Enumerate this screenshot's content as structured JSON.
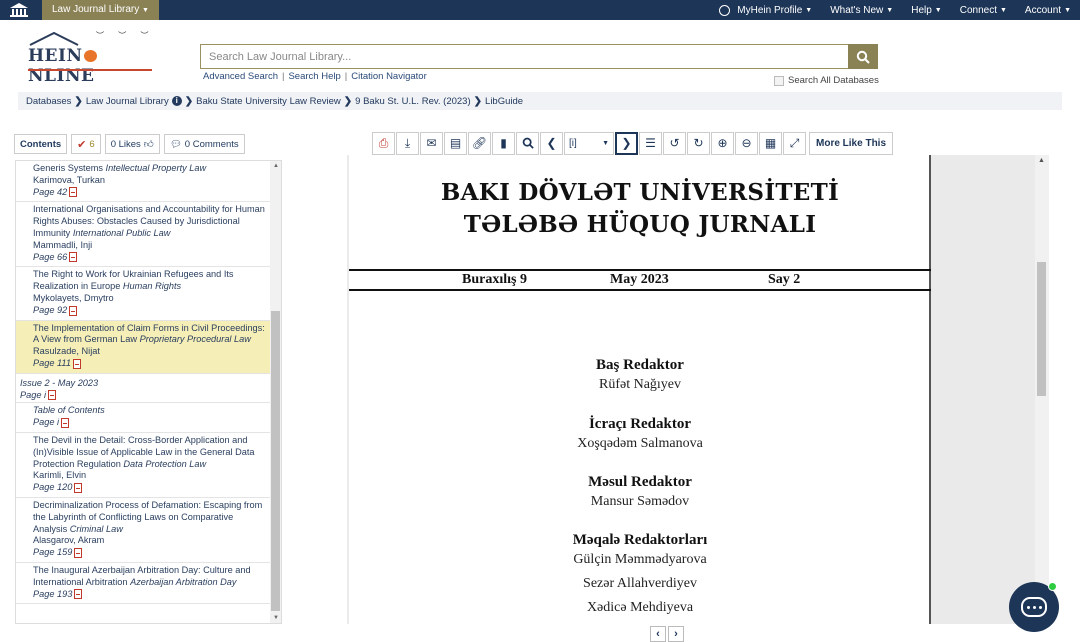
{
  "topnav": {
    "library_tab": "Law Journal Library",
    "items": [
      "MyHein Profile",
      "What's New",
      "Help",
      "Connect",
      "Account"
    ]
  },
  "logo": {
    "text_left": "HEIN",
    "text_right": "NLINE"
  },
  "search": {
    "placeholder": "Search Law Journal Library...",
    "links": [
      "Advanced Search",
      "Search Help",
      "Citation Navigator"
    ],
    "search_all_label": "Search All Databases"
  },
  "breadcrumb": [
    "Databases",
    "Law Journal Library",
    "Baku State University Law Review",
    "9 Baku St. U.L. Rev. (2023)",
    "LibGuide"
  ],
  "left_buttons": {
    "contents": "Contents",
    "count": "6",
    "likes": "0 Likes",
    "comments": "0 Comments"
  },
  "toc": [
    {
      "title": "Generis Systems",
      "category": "Intellectual Property Law",
      "author": "Karimova, Turkan",
      "page": "Page 42"
    },
    {
      "title": "International Organisations and Accountability for Human Rights Abuses: Obstacles Caused by Jurisdictional Immunity",
      "category": "International Public Law",
      "author": "Mammadli, Inji",
      "page": "Page 66"
    },
    {
      "title": "The Right to Work for Ukrainian Refugees and Its Realization in Europe",
      "category": "Human Rights",
      "author": "Mykolayets, Dmytro",
      "page": "Page 92"
    },
    {
      "title": "The Implementation of Claim Forms in Civil Proceedings: A View from German Law",
      "category": "Proprietary Procedural Law",
      "author": "Rasulzade, Nijat",
      "page": "Page 111",
      "highlight": true
    }
  ],
  "issue": {
    "label": "Issue 2 - May 2023",
    "page": "Page i"
  },
  "toc2": [
    {
      "title": "Table of Contents",
      "category": "",
      "author": "",
      "page": "Page i",
      "italic_title": true
    },
    {
      "title": "The Devil in the Detail: Cross-Border Application and (In)Visible Issue of Applicable Law in the General Data Protection Regulation",
      "category": "Data Protection Law",
      "author": "Karimli, Elvin",
      "page": "Page 120"
    },
    {
      "title": "Decriminalization Process of Defamation: Escaping from the Labyrinth of Conflicting Laws on Comparative Analysis",
      "category": "Criminal Law",
      "author": "Alasgarov, Akram",
      "page": "Page 159"
    },
    {
      "title": "The Inaugural Azerbaijan Arbitration Day: Culture and International Arbitration",
      "category": "Azerbaijan Arbitration Day",
      "author": "",
      "page": "Page 193"
    }
  ],
  "toolbar": {
    "more_like_this": "More Like This",
    "page_select": "[i]"
  },
  "document": {
    "title_line1": "BAKI DÖVLƏT UNİVERSİTETİ",
    "title_line2": "TƏLƏBƏ HÜQUQ JURNALI",
    "issue": "Buraxılış 9",
    "date": "May 2023",
    "number": "Say 2",
    "roles": [
      {
        "role": "Baş Redaktor",
        "names": [
          "Rüfət Nağıyev"
        ]
      },
      {
        "role": "İcraçı Redaktor",
        "names": [
          "Xoşqədəm Salmanova"
        ]
      },
      {
        "role": "Məsul Redaktor",
        "names": [
          "Mansur Səmədov"
        ]
      },
      {
        "role": "Məqalə Redaktorları",
        "names": [
          "Gülçin Məmmədyarova",
          "Sezər Allahverdiyev",
          "Xədicə Mehdiyeva"
        ]
      }
    ]
  },
  "colors": {
    "nav": "#1d3557",
    "accent": "#8a8155",
    "highlight": "#f5eeb7"
  }
}
